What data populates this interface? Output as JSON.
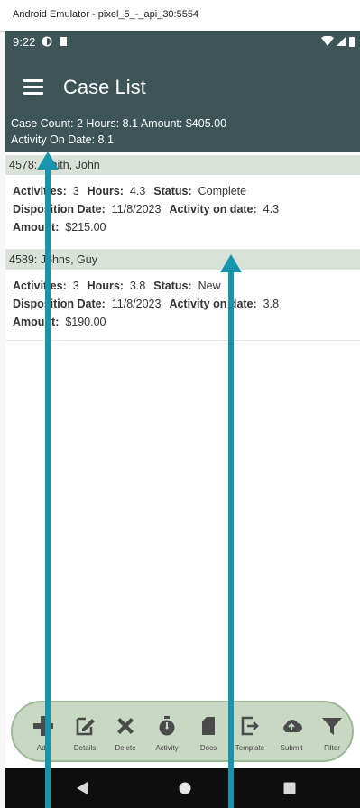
{
  "window": {
    "title": "Android Emulator - pixel_5_-_api_30:5554"
  },
  "status_bar": {
    "time": "9:22"
  },
  "app_bar": {
    "title": "Case List",
    "menu_icon": "hamburger-menu-icon"
  },
  "summary": {
    "line1": "Case Count: 2 Hours: 8.1 Amount: $405.00",
    "line2": "Activity On Date: 8.1"
  },
  "cases": [
    {
      "header": "4578: Smith, John",
      "activities_label": "Activities:",
      "activities": "3",
      "hours_label": "Hours:",
      "hours": "4.3",
      "status_label": "Status:",
      "status": "Complete",
      "disposition_label": "Disposition Date:",
      "disposition": "11/8/2023",
      "activity_on_date_label": "Activity on date:",
      "activity_on_date": "4.3",
      "amount_label": "Amount:",
      "amount": "$215.00"
    },
    {
      "header": "4589: Johns, Guy",
      "activities_label": "Activities:",
      "activities": "3",
      "hours_label": "Hours:",
      "hours": "3.8",
      "status_label": "Status:",
      "status": "New",
      "disposition_label": "Disposition Date:",
      "disposition": "11/8/2023",
      "activity_on_date_label": "Activity on date:",
      "activity_on_date": "3.8",
      "amount_label": "Amount:",
      "amount": "$190.00"
    }
  ],
  "toolbar": {
    "add": "Add",
    "details": "Details",
    "delete": "Delete",
    "activity": "Activity",
    "docs": "Docs",
    "template": "Template",
    "submit": "Submit",
    "filter": "Filter"
  },
  "colors": {
    "appbar": "#3d5556",
    "case_header": "#d8e2d8",
    "toolbar_bg": "#c7d8c3",
    "annotation_arrow": "#1695ad"
  }
}
